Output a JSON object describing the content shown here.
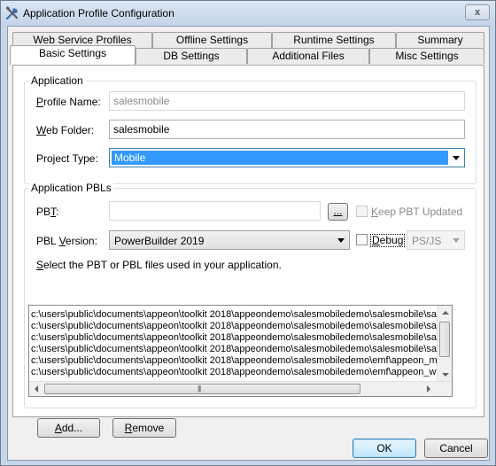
{
  "window": {
    "title": "Application Profile Configuration",
    "close_label": "x"
  },
  "tabs": {
    "row1": [
      "Web Service Profiles",
      "Offline Settings",
      "Runtime Settings",
      "Summary"
    ],
    "row2": [
      "Basic Settings",
      "DB Settings",
      "Additional Files",
      "Misc Settings"
    ],
    "active": "Basic Settings"
  },
  "application": {
    "legend": "Application",
    "profile_name_label_pre": "",
    "profile_name_label_key": "P",
    "profile_name_label_post": "rofile Name:",
    "profile_name_value": "salesmobile",
    "web_folder_label_key": "W",
    "web_folder_label_post": "eb Folder:",
    "web_folder_value": "salesmobile",
    "project_type_label": "Project Type:",
    "project_type_value": "Mobile"
  },
  "pbls": {
    "legend": "Application PBLs",
    "pbt_label_pre": "PB",
    "pbt_label_key": "T",
    "pbt_label_post": ":",
    "pbt_value": "",
    "browse_label_key": "...",
    "keep_pbt_label_key": "K",
    "keep_pbt_label_post": "eep PBT Updated",
    "pbl_version_label_pre": "PBL ",
    "pbl_version_label_key": "V",
    "pbl_version_label_post": "ersion:",
    "pbl_version_value": "PowerBuilder 2019",
    "debug_label_key": "D",
    "debug_label_post": "ebug",
    "mode_value": "PS/JS",
    "instruction_pre": "",
    "instruction_key": "S",
    "instruction_post": "elect the PBT or PBL files used in your application.",
    "files": [
      "c:\\users\\public\\documents\\appeon\\toolkit 2018\\appeondemo\\salesmobiledemo\\salesmobile\\sal",
      "c:\\users\\public\\documents\\appeon\\toolkit 2018\\appeondemo\\salesmobiledemo\\salesmobile\\sal",
      "c:\\users\\public\\documents\\appeon\\toolkit 2018\\appeondemo\\salesmobiledemo\\salesmobile\\sal",
      "c:\\users\\public\\documents\\appeon\\toolkit 2018\\appeondemo\\salesmobiledemo\\salesmobile\\sal",
      "c:\\users\\public\\documents\\appeon\\toolkit 2018\\appeondemo\\salesmobiledemo\\emf\\appeon_m",
      "c:\\users\\public\\documents\\appeon\\toolkit 2018\\appeondemo\\salesmobiledemo\\emf\\appeon_w"
    ]
  },
  "buttons": {
    "add_key": "A",
    "add_post": "dd...",
    "remove_key": "R",
    "remove_post": "emove",
    "ok": "OK",
    "cancel": "Cancel"
  }
}
